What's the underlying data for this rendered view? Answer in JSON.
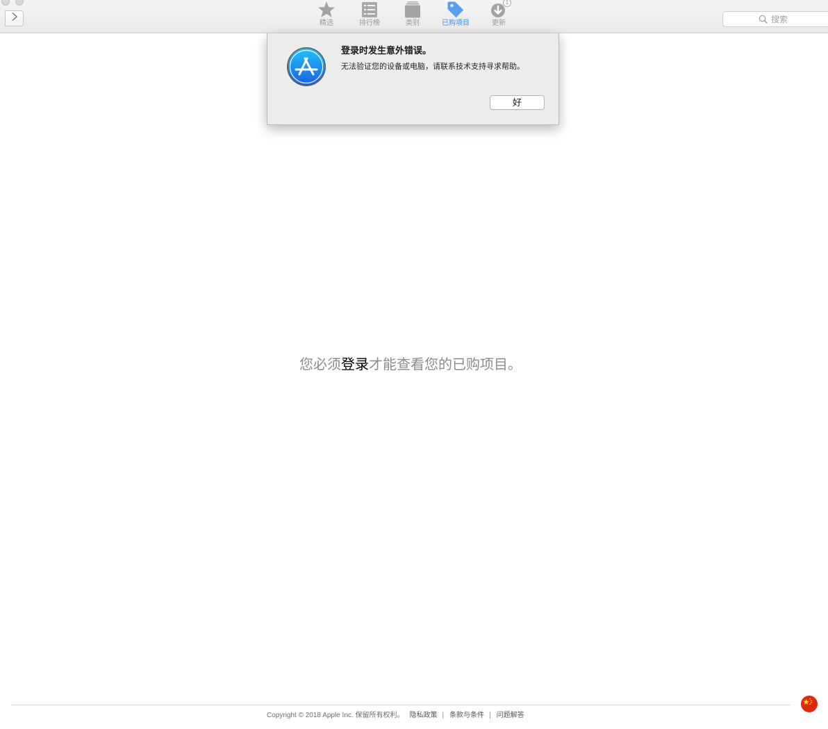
{
  "colors": {
    "accent": "#3b8ff0",
    "muted_text": "#8c8c8c",
    "sign_in_link": "#000000",
    "flag_red": "#de2910"
  },
  "toolbar": {
    "nav": {
      "forward_icon": "chevron-right-icon"
    },
    "tabs": [
      {
        "label": "精选",
        "icon": "star-icon",
        "selected": false
      },
      {
        "label": "排行榜",
        "icon": "list-icon",
        "selected": false
      },
      {
        "label": "类别",
        "icon": "category-icon",
        "selected": false
      },
      {
        "label": "已购项目",
        "icon": "tag-icon",
        "selected": true
      },
      {
        "label": "更新",
        "icon": "download-icon",
        "selected": false,
        "badge": "1"
      }
    ],
    "search": {
      "placeholder": "搜索",
      "value": "",
      "icon": "search-icon"
    }
  },
  "dialog": {
    "icon": "app-store-icon",
    "title": "登录时发生意外错误。",
    "message": "无法验证您的设备或电脑，请联系技术支持寻求帮助。",
    "ok_label": "好"
  },
  "main": {
    "message_before": "您必须",
    "sign_in_link": "登录",
    "message_after": "才能查看您的已购项目。"
  },
  "footer": {
    "copyright": "Copyright © 2018 Apple Inc. 保留所有权利。",
    "links": [
      "隐私政策",
      "条款与条件",
      "问题解答"
    ],
    "separator": "|",
    "region_icon": "china-flag-icon"
  }
}
